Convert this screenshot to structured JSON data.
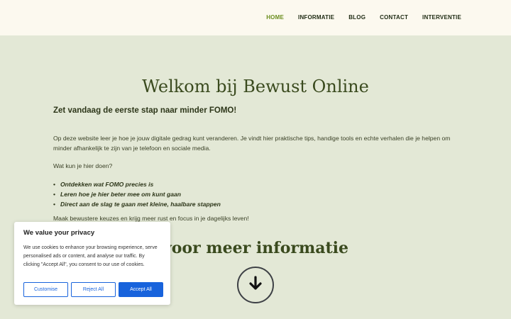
{
  "nav": {
    "items": [
      {
        "label": "HOME",
        "active": true
      },
      {
        "label": "INFORMATIE",
        "active": false
      },
      {
        "label": "BLOG",
        "active": false
      },
      {
        "label": "CONTACT",
        "active": false
      },
      {
        "label": "INTERVENTIE",
        "active": false
      }
    ],
    "active_color": "#6a8d1c"
  },
  "hero": {
    "title": "Welkom bij Bewust Online",
    "subtitle": "Zet vandaag de eerste stap naar minder FOMO!",
    "intro": "Op deze website leer je hoe je jouw digitale gedrag kunt veranderen. Je vindt hier praktische tips, handige tools en echte verhalen die je helpen om minder afhankelijk te zijn van je telefoon en sociale media.",
    "question": "Wat kun je hier doen?",
    "bullets": [
      "Ontdekken wat FOMO precies is",
      "Leren hoe je hier beter mee om kunt gaan",
      "Direct aan de slag te gaan met kleine, haalbare stappen"
    ],
    "closing": "Maak bewustere keuzes en krijg meer rust en focus in je dagelijks leven!"
  },
  "more": {
    "title": "voor meer informatie",
    "arrow_icon": "arrow-down-icon"
  },
  "cookie": {
    "title": "We value your privacy",
    "text": "We use cookies to enhance your browsing experience, serve personalised ads or content, and analyse our traffic. By clicking \"Accept All\", you consent to our use of cookies.",
    "customise_label": "Customise",
    "reject_label": "Reject All",
    "accept_label": "Accept All",
    "accent": "#1863dc"
  },
  "colors": {
    "header_bg": "#fcf9ef",
    "page_bg": "#e3e8d6"
  }
}
